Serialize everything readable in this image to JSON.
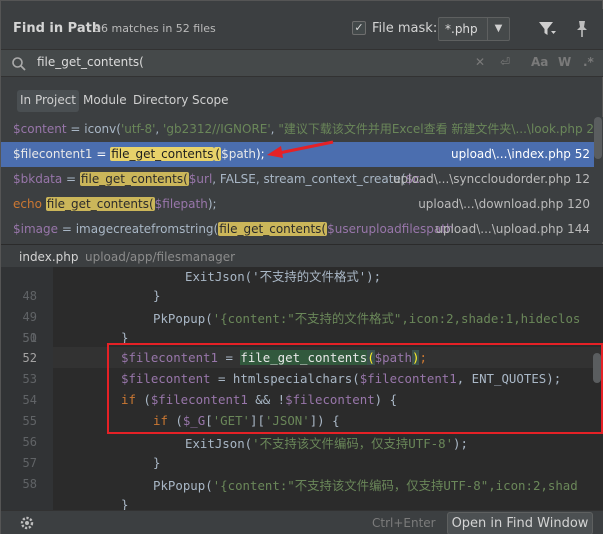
{
  "header": {
    "title": "Find in Path",
    "matches": "96 matches in 52 files",
    "file_mask_label": "File mask:",
    "file_mask_checked": true,
    "file_mask_value": "*.php"
  },
  "search": {
    "query": "file_get_contents(",
    "options": [
      "Aa",
      "W",
      ".*"
    ]
  },
  "scopes": [
    {
      "label": "In Project",
      "active": true
    },
    {
      "label": "Module",
      "active": false
    },
    {
      "label": "Directory",
      "active": false
    },
    {
      "label": "Scope",
      "active": false
    }
  ],
  "results": [
    {
      "pre_var": "$content",
      "pre_plain": " = iconv(",
      "str1": "'utf-8'",
      "mid": ", ",
      "str2": "'gb2312//IGNORE'",
      "mid2": ", ",
      "str3": "\"建议下载该文件并用Excel查看 新建文件夹\\...\\look.php 24",
      "location": ""
    },
    {
      "pre_var": "$filecontent1",
      "pre_plain": " = ",
      "match": "file_get_contents",
      "match_paren": "(",
      "post_var": "$path",
      "post_plain": ");",
      "location": "upload\\...\\index.php 52",
      "selected": true
    },
    {
      "pre_var": "$bkdata",
      "pre_plain": " = ",
      "match": "file_get_contents(",
      "post_var": "$url",
      "post_plain": ", FALSE, stream_context_create(",
      "post_var2": "$c",
      "location": "upload\\...\\synccloudorder.php 12"
    },
    {
      "pre_kw": "echo",
      "match": "file_get_contents(",
      "post_var": "$filepath",
      "post_plain": ");",
      "location": "upload\\...\\download.php 120"
    },
    {
      "pre_var": "$image",
      "pre_plain": " = imagecreatefromstring(",
      "match": "file_get_contents(",
      "post_var": "$useruploadfilespath",
      "location": "upload\\...\\upload.php 144"
    }
  ],
  "preview": {
    "file": "index.php",
    "path": "upload/app/filesmanager"
  },
  "editor": {
    "line_numbers": [
      "",
      "48",
      "49",
      "50",
      "51",
      "52",
      "53",
      "54",
      "55",
      "56",
      "57",
      "58",
      ""
    ],
    "current_line": "52",
    "lines": {
      "l47": "ExitJson('不支持的文件格式');",
      "l48": "}",
      "l49_fn": "PkPopup(",
      "l49_str": "'{content:\"不支持的文件格式\",icon:2,shade:1,hideclos",
      "l50": "}",
      "l51": "",
      "l52_var": "$filecontent1",
      "l52_eq": " = ",
      "l52_fn": "file_get_contents",
      "l52_po": "(",
      "l52_arg": "$path",
      "l52_pc": ")",
      "l52_end": ";",
      "l53_var": "$filecontent",
      "l53_mid": " = htmlspecialchars(",
      "l53_var2": "$filecontent1",
      "l53_end": ", ENT_QUOTES);",
      "l54_kw": "if",
      "l54_a": " (",
      "l54_var": "$filecontent1",
      "l54_b": " && !",
      "l54_var2": "$filecontent",
      "l54_c": ") {",
      "l55_kw": "if",
      "l55_a": " (",
      "l55_var": "$_G",
      "l55_s1": "'GET'",
      "l55_s2": "'JSON'",
      "l55_c": "]) {",
      "l56_fn": "ExitJson(",
      "l56_str": "'不支持该文件编码，仅支持UTF-8'",
      "l56_end": ");",
      "l57": "}",
      "l58_fn": "PkPopup(",
      "l58_str": "'{content:\"不支持该文件编码，仅支持UTF-8\",icon:2,shad",
      "l59": "}"
    }
  },
  "footer": {
    "shortcut": "Ctrl+Enter",
    "open_button": "Open in Find Window"
  },
  "colors": {
    "accent_selection": "#4b6eaf",
    "match_highlight": "#cbb65a",
    "annotation_red": "#e52126"
  }
}
